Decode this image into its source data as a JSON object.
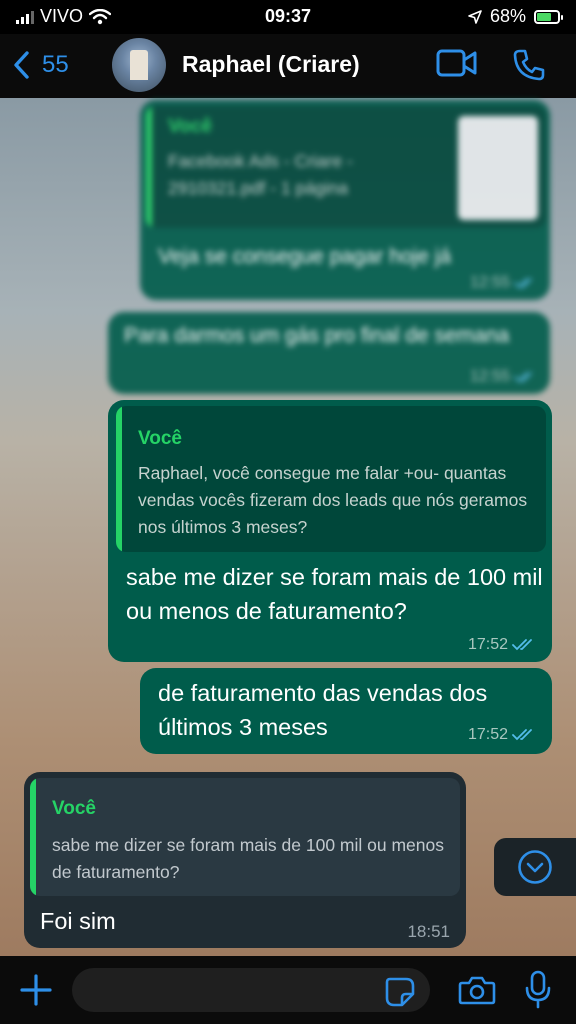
{
  "status_bar": {
    "carrier": "VIVO",
    "time": "09:37",
    "battery_percent": "68%",
    "battery_level": 0.68
  },
  "header": {
    "back_count": "55",
    "contact_name": "Raphael (Criare)"
  },
  "messages": [
    {
      "type": "outgoing",
      "blurred": true,
      "quote_author": "Você",
      "quote_text": "Facebook Ads - Criare - 2910321.pdf - 1 página",
      "text": "Veja se consegue pagar hoje já",
      "time": "12:55"
    },
    {
      "type": "outgoing",
      "blurred": true,
      "text": "Para darmos um gás pro final de semana",
      "time": "12:55"
    },
    {
      "type": "outgoing",
      "quote_author": "Você",
      "quote_text": "Raphael, você consegue me falar +ou- quantas vendas vocês fizeram dos leads que nós geramos nos últimos 3 meses?",
      "text": "sabe me dizer se foram mais de 100 mil ou menos de faturamento?",
      "time": "17:52"
    },
    {
      "type": "outgoing",
      "text": "de faturamento das vendas dos últimos 3 meses",
      "time": "17:52"
    },
    {
      "type": "incoming",
      "quote_author": "Você",
      "quote_text": "sabe me dizer se foram mais de 100 mil ou menos de faturamento?",
      "text": "Foi sim",
      "time": "18:51"
    }
  ],
  "input": {
    "placeholder": ""
  },
  "colors": {
    "accent": "#2e8fe8",
    "outgoing_bubble": "#005c4b",
    "incoming_bubble": "#202c33",
    "quote_green": "#25d366"
  },
  "icons": [
    "signal-icon",
    "wifi-icon",
    "location-arrow-icon",
    "battery-icon",
    "back-chevron-icon",
    "video-call-icon",
    "phone-icon",
    "read-receipt-icon",
    "scroll-down-icon",
    "plus-icon",
    "sticker-icon",
    "camera-icon",
    "microphone-icon"
  ]
}
